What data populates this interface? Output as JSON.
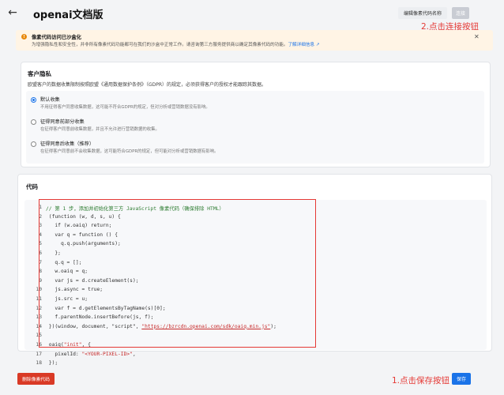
{
  "header": {
    "back_icon": "arrow-left-icon",
    "title": "openai文档版",
    "edit_name_label": "编辑像素代码名称",
    "connect_label": "连接"
  },
  "annotations": {
    "connect_step": "2.点击连接按钮",
    "save_step": "1.点击保存按钮",
    "color": "#e53935"
  },
  "banner": {
    "title": "像素代码访问已沙盒化",
    "description": "为增强隐私性和安全性，并非所有像素代码功能都可在我们的沙盒中正常工作。请咨询第三方服务提供商以确定其像素代码的功能。",
    "link": "了解详细信息",
    "icon": "warning-icon",
    "close_icon": "close-icon"
  },
  "privacy": {
    "heading": "客户隐私",
    "description": "欧盟客户的数据收集限制按照欧盟《通用数据保护条例》（GDPR）的规定，必须获得客户的授权才能跟踪其数据。",
    "options": [
      {
        "title": "默认收集",
        "subtitle": "不用征得客户同意收集数据，这可能不符合GDPR的规定，但对分析或营销数据没有影响。",
        "selected": true
      },
      {
        "title": "征得同意前部分收集",
        "subtitle": "在征得客户同意前收集数据，并且不允许进行营销数据的收集。",
        "selected": false
      },
      {
        "title": "征得同意后收集（推荐）",
        "subtitle": "在征得客户同意前不会收集数据，这可能符合GDPR的规定，但可能对分析或营销数据有影响。",
        "selected": false
      }
    ]
  },
  "code": {
    "heading": "代码",
    "line_numbers": [
      "1",
      "2",
      "3",
      "4",
      "5",
      "6",
      "7",
      "8",
      "9",
      "10",
      "11",
      "12",
      "13",
      "14",
      "15",
      "16",
      "17",
      "18"
    ],
    "lines": {
      "l1": "// 第 1 步，添加并初始化第三方 JavaScript 像素代码（确保排除 HTML）",
      "l2": " (function (w, d, s, u) {",
      "l3": "   if (w.oaiq) return;",
      "l4": "   var q = function () {",
      "l5": "     q.q.push(arguments);",
      "l6": "   };",
      "l7": "   q.q = [];",
      "l8": "   w.oaiq = q;",
      "l9": "   var js = d.createElement(s);",
      "l10": "   js.async = true;",
      "l11": "   js.src = u;",
      "l12": "   var f = d.getElementsByTagName(s)[0];",
      "l13": "   f.parentNode.insertBefore(js, f);",
      "l14_pre": " })(window, document, \"script\", ",
      "l14_url": "\"https://bzrcdn.openai.com/sdk/oaiq.min.js\"",
      "l14_post": ");",
      "l15": "",
      "l16_pre": " oaiq(",
      "l16_str": "\"init\"",
      "l16_post": ", {",
      "l17_pre": "   pixelId: ",
      "l17_str": "\"<YOUR-PIXEL-ID>\"",
      "l17_post": ",",
      "l18": " });"
    }
  },
  "footer": {
    "delete_label": "删除像素代码",
    "save_label": "保存"
  }
}
